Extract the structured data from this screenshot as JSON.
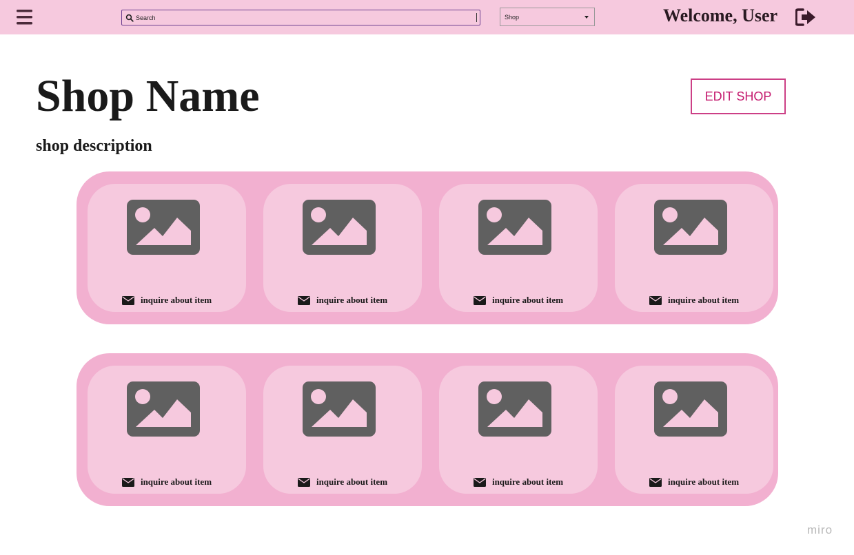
{
  "header": {
    "menu_icon": "hamburger-menu-icon",
    "search_placeholder": "Search",
    "search_icon": "search-icon",
    "select_value": "Shop",
    "welcome": "Welcome, User",
    "logout_icon": "sign-out-icon"
  },
  "shop": {
    "name": "Shop Name",
    "description": "shop description",
    "edit_label": "EDIT SHOP"
  },
  "items": [
    {
      "inquire": "inquire about item"
    },
    {
      "inquire": "inquire about item"
    },
    {
      "inquire": "inquire about item"
    },
    {
      "inquire": "inquire about item"
    },
    {
      "inquire": "inquire about item"
    },
    {
      "inquire": "inquire about item"
    },
    {
      "inquire": "inquire about item"
    },
    {
      "inquire": "inquire about item"
    }
  ],
  "watermark": "miro",
  "colors": {
    "topbar": "#f6c9de",
    "row_bg": "#f2b0d0",
    "card_bg": "#f6c9de",
    "accent": "#c4196e",
    "icon_gray": "#606060"
  }
}
